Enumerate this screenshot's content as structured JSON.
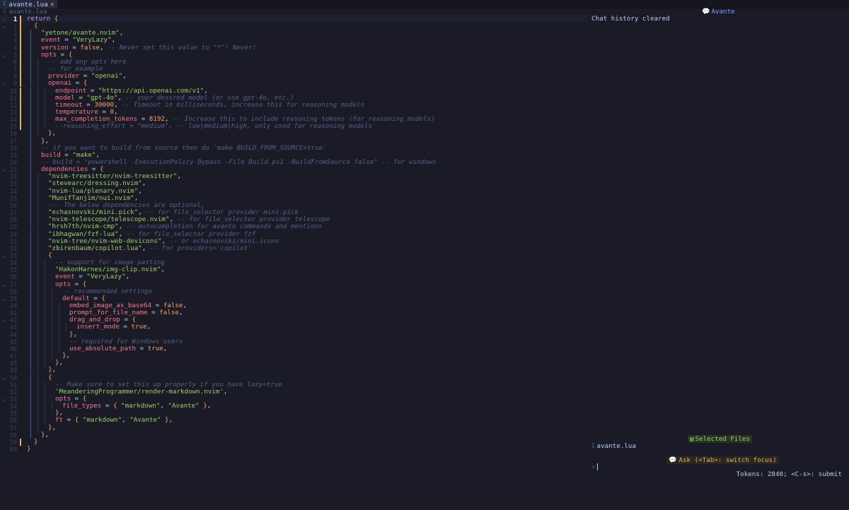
{
  "tab": {
    "icon": "lua-file-icon",
    "label": "avante.lua",
    "close_icon": "close-icon"
  },
  "winbar": {
    "icon": "lua-file-icon",
    "label": "avante.lua"
  },
  "editor": {
    "current_line": 1,
    "lines": [
      {
        "n": "1",
        "fold": "⌄",
        "sign": true,
        "indent": 0,
        "tokens": [
          [
            "k",
            "return"
          ],
          [
            "p",
            " "
          ],
          [
            "br2",
            "{"
          ]
        ]
      },
      {
        "n": "1",
        "fold": "⌄",
        "sign": true,
        "indent": 1,
        "tokens": [
          [
            "br1",
            "{"
          ]
        ]
      },
      {
        "n": "2",
        "sign": true,
        "indent": 2,
        "tokens": [
          [
            "s",
            "\"yetone/avante.nvim\""
          ],
          [
            "p",
            ","
          ]
        ]
      },
      {
        "n": "3",
        "sign": true,
        "indent": 2,
        "tokens": [
          [
            "f",
            "event"
          ],
          [
            "p",
            " = "
          ],
          [
            "s",
            "\"VeryLazy\""
          ],
          [
            "p",
            ","
          ]
        ]
      },
      {
        "n": "4",
        "sign": true,
        "indent": 2,
        "tokens": [
          [
            "f",
            "version"
          ],
          [
            "p",
            " = "
          ],
          [
            "b",
            "false"
          ],
          [
            "p",
            ", "
          ],
          [
            "c",
            "-- Never set this value to \"*\"! Never!"
          ]
        ]
      },
      {
        "n": "5",
        "fold": "⌄",
        "sign": true,
        "indent": 2,
        "tokens": [
          [
            "f",
            "opts"
          ],
          [
            "p",
            " = "
          ],
          [
            "br2",
            "{"
          ]
        ]
      },
      {
        "n": "6",
        "sign": true,
        "indent": 3,
        "tokens": [
          [
            "c",
            "-- add any opts here"
          ]
        ]
      },
      {
        "n": "7",
        "sign": true,
        "indent": 3,
        "tokens": [
          [
            "c",
            "-- for example"
          ]
        ]
      },
      {
        "n": "8",
        "sign": true,
        "indent": 3,
        "tokens": [
          [
            "f",
            "provider"
          ],
          [
            "p",
            " = "
          ],
          [
            "s",
            "\"openai\""
          ],
          [
            "p",
            ","
          ]
        ]
      },
      {
        "n": "9",
        "fold": "⌄",
        "sign": true,
        "indent": 3,
        "tokens": [
          [
            "f",
            "openai"
          ],
          [
            "p",
            " = "
          ],
          [
            "br1",
            "{"
          ]
        ]
      },
      {
        "n": "10",
        "sign": true,
        "indent": 4,
        "tokens": [
          [
            "f",
            "endpoint"
          ],
          [
            "p",
            " = "
          ],
          [
            "s",
            "\"https://api.openai.com/v1\""
          ],
          [
            "p",
            ","
          ]
        ]
      },
      {
        "n": "11",
        "sign": true,
        "indent": 4,
        "tokens": [
          [
            "f",
            "model"
          ],
          [
            "p",
            " = "
          ],
          [
            "s",
            "\"gpt-4o\""
          ],
          [
            "p",
            ", "
          ],
          [
            "c",
            "-- your desired model (or use gpt-4o, etc.)"
          ]
        ]
      },
      {
        "n": "12",
        "sign": true,
        "indent": 4,
        "tokens": [
          [
            "f",
            "timeout"
          ],
          [
            "p",
            " = "
          ],
          [
            "n",
            "30000"
          ],
          [
            "p",
            ", "
          ],
          [
            "c",
            "-- Timeout in milliseconds, increase this for reasoning models"
          ]
        ]
      },
      {
        "n": "13",
        "sign": true,
        "indent": 4,
        "tokens": [
          [
            "f",
            "temperature"
          ],
          [
            "p",
            " = "
          ],
          [
            "n",
            "0"
          ],
          [
            "p",
            ","
          ]
        ]
      },
      {
        "n": "14",
        "sign": true,
        "indent": 4,
        "tokens": [
          [
            "f",
            "max_completion_tokens"
          ],
          [
            "p",
            " = "
          ],
          [
            "n",
            "8192"
          ],
          [
            "p",
            ", "
          ],
          [
            "c",
            "-- Increase this to include reasoning tokens (for reasoning models)"
          ]
        ]
      },
      {
        "n": "15",
        "sign": true,
        "indent": 4,
        "tokens": [
          [
            "c",
            "--reasoning_effort = \"medium\", -- low|medium|high, only used for reasoning models"
          ]
        ]
      },
      {
        "n": "16",
        "indent": 3,
        "tokens": [
          [
            "br1",
            "}"
          ],
          [
            "p",
            ","
          ]
        ]
      },
      {
        "n": "17",
        "indent": 2,
        "tokens": [
          [
            "br2",
            "}"
          ],
          [
            "p",
            ","
          ]
        ]
      },
      {
        "n": "18",
        "indent": 2,
        "tokens": [
          [
            "c",
            "-- if you want to build from source then do `make BUILD_FROM_SOURCE=true`"
          ]
        ]
      },
      {
        "n": "19",
        "indent": 2,
        "tokens": [
          [
            "f",
            "build"
          ],
          [
            "p",
            " = "
          ],
          [
            "s",
            "\"make\""
          ],
          [
            "p",
            ","
          ]
        ]
      },
      {
        "n": "20",
        "indent": 2,
        "tokens": [
          [
            "c",
            "-- build = \"powershell -ExecutionPolicy Bypass -File Build.ps1 -BuildFromSource false\" -- for windows"
          ]
        ]
      },
      {
        "n": "21",
        "fold": "⌄",
        "indent": 2,
        "tokens": [
          [
            "f",
            "dependencies"
          ],
          [
            "p",
            " = "
          ],
          [
            "br2",
            "{"
          ]
        ]
      },
      {
        "n": "22",
        "indent": 3,
        "tokens": [
          [
            "s",
            "\"nvim-treesitter/nvim-treesitter\""
          ],
          [
            "p",
            ","
          ]
        ]
      },
      {
        "n": "23",
        "indent": 3,
        "tokens": [
          [
            "s",
            "\"stevearc/dressing.nvim\""
          ],
          [
            "p",
            ","
          ]
        ]
      },
      {
        "n": "24",
        "indent": 3,
        "tokens": [
          [
            "s",
            "\"nvim-lua/plenary.nvim\""
          ],
          [
            "p",
            ","
          ]
        ]
      },
      {
        "n": "25",
        "indent": 3,
        "tokens": [
          [
            "s",
            "\"MunifTanjim/nui.nvim\""
          ],
          [
            "p",
            ","
          ]
        ]
      },
      {
        "n": "26",
        "indent": 3,
        "tokens": [
          [
            "c",
            "--- The below dependencies are optional,"
          ]
        ]
      },
      {
        "n": "27",
        "indent": 3,
        "tokens": [
          [
            "s",
            "\"echasnovski/mini.pick\""
          ],
          [
            "p",
            ", "
          ],
          [
            "c",
            "-- for file_selector provider mini.pick"
          ]
        ]
      },
      {
        "n": "28",
        "indent": 3,
        "tokens": [
          [
            "s",
            "\"nvim-telescope/telescope.nvim\""
          ],
          [
            "p",
            ", "
          ],
          [
            "c",
            "-- for file_selector provider telescope"
          ]
        ]
      },
      {
        "n": "29",
        "indent": 3,
        "tokens": [
          [
            "s",
            "\"hrsh7th/nvim-cmp\""
          ],
          [
            "p",
            ", "
          ],
          [
            "c",
            "-- autocompletion for avante commands and mentions"
          ]
        ]
      },
      {
        "n": "30",
        "indent": 3,
        "tokens": [
          [
            "s",
            "\"ibhagwan/fzf-lua\""
          ],
          [
            "p",
            ", "
          ],
          [
            "c",
            "-- for file_selector provider fzf"
          ]
        ]
      },
      {
        "n": "31",
        "indent": 3,
        "tokens": [
          [
            "s",
            "\"nvim-tree/nvim-web-devicons\""
          ],
          [
            "p",
            ", "
          ],
          [
            "c",
            "-- or echasnovski/mini.icons"
          ]
        ]
      },
      {
        "n": "32",
        "indent": 3,
        "tokens": [
          [
            "s",
            "\"zbirenbaum/copilot.lua\""
          ],
          [
            "p",
            ", "
          ],
          [
            "c",
            "-- for providers='copilot'"
          ]
        ]
      },
      {
        "n": "33",
        "fold": "⌄",
        "indent": 3,
        "tokens": [
          [
            "br1",
            "{"
          ]
        ]
      },
      {
        "n": "34",
        "indent": 4,
        "tokens": [
          [
            "c",
            "-- support for image pasting"
          ]
        ]
      },
      {
        "n": "35",
        "indent": 4,
        "tokens": [
          [
            "s",
            "\"HakonHarnes/img-clip.nvim\""
          ],
          [
            "p",
            ","
          ]
        ]
      },
      {
        "n": "36",
        "indent": 4,
        "tokens": [
          [
            "f",
            "event"
          ],
          [
            "p",
            " = "
          ],
          [
            "s",
            "\"VeryLazy\""
          ],
          [
            "p",
            ","
          ]
        ]
      },
      {
        "n": "37",
        "fold": "⌄",
        "indent": 4,
        "tokens": [
          [
            "f",
            "opts"
          ],
          [
            "p",
            " = "
          ],
          [
            "br2",
            "{"
          ]
        ]
      },
      {
        "n": "38",
        "indent": 5,
        "tokens": [
          [
            "c",
            "-- recommended settings"
          ]
        ]
      },
      {
        "n": "39",
        "fold": "⌄",
        "indent": 5,
        "tokens": [
          [
            "f",
            "default"
          ],
          [
            "p",
            " = "
          ],
          [
            "br1",
            "{"
          ]
        ]
      },
      {
        "n": "40",
        "indent": 6,
        "tokens": [
          [
            "f",
            "embed_image_as_base64"
          ],
          [
            "p",
            " = "
          ],
          [
            "b",
            "false"
          ],
          [
            "p",
            ","
          ]
        ]
      },
      {
        "n": "41",
        "indent": 6,
        "tokens": [
          [
            "f",
            "prompt_for_file_name"
          ],
          [
            "p",
            " = "
          ],
          [
            "b",
            "false"
          ],
          [
            "p",
            ","
          ]
        ]
      },
      {
        "n": "42",
        "fold": "⌄",
        "indent": 6,
        "tokens": [
          [
            "f",
            "drag_and_drop"
          ],
          [
            "p",
            " = "
          ],
          [
            "br2",
            "{"
          ]
        ]
      },
      {
        "n": "43",
        "indent": 7,
        "tokens": [
          [
            "f",
            "insert_mode"
          ],
          [
            "p",
            " = "
          ],
          [
            "b",
            "true"
          ],
          [
            "p",
            ","
          ]
        ]
      },
      {
        "n": "44",
        "indent": 6,
        "tokens": [
          [
            "br2",
            "}"
          ],
          [
            "p",
            ","
          ]
        ]
      },
      {
        "n": "45",
        "indent": 6,
        "tokens": [
          [
            "c",
            "-- required for Windows users"
          ]
        ]
      },
      {
        "n": "46",
        "indent": 6,
        "tokens": [
          [
            "f",
            "use_absolute_path"
          ],
          [
            "p",
            " = "
          ],
          [
            "b",
            "true"
          ],
          [
            "p",
            ","
          ]
        ]
      },
      {
        "n": "47",
        "indent": 5,
        "tokens": [
          [
            "br1",
            "}"
          ],
          [
            "p",
            ","
          ]
        ]
      },
      {
        "n": "48",
        "indent": 4,
        "tokens": [
          [
            "br2",
            "}"
          ],
          [
            "p",
            ","
          ]
        ]
      },
      {
        "n": "49",
        "indent": 3,
        "tokens": [
          [
            "br1",
            "}"
          ],
          [
            "p",
            ","
          ]
        ]
      },
      {
        "n": "50",
        "fold": "⌄",
        "indent": 3,
        "tokens": [
          [
            "br1",
            "{"
          ]
        ]
      },
      {
        "n": "51",
        "indent": 4,
        "tokens": [
          [
            "c",
            "-- Make sure to set this up properly if you have lazy=true"
          ]
        ]
      },
      {
        "n": "52",
        "indent": 4,
        "tokens": [
          [
            "s",
            "'MeanderingProgrammer/render-markdown.nvim'"
          ],
          [
            "p",
            ","
          ]
        ]
      },
      {
        "n": "53",
        "fold": "⌄",
        "indent": 4,
        "tokens": [
          [
            "f",
            "opts"
          ],
          [
            "p",
            " = "
          ],
          [
            "br2",
            "{"
          ]
        ]
      },
      {
        "n": "54",
        "indent": 5,
        "tokens": [
          [
            "f",
            "file_types"
          ],
          [
            "p",
            " = "
          ],
          [
            "br1",
            "{"
          ],
          [
            "p",
            " "
          ],
          [
            "s",
            "\"markdown\""
          ],
          [
            "p",
            ", "
          ],
          [
            "s",
            "\"Avante\""
          ],
          [
            "p",
            " "
          ],
          [
            "br1",
            "}"
          ],
          [
            "p",
            ","
          ]
        ]
      },
      {
        "n": "55",
        "indent": 4,
        "tokens": [
          [
            "br2",
            "}"
          ],
          [
            "p",
            ","
          ]
        ]
      },
      {
        "n": "56",
        "indent": 4,
        "tokens": [
          [
            "f",
            "ft"
          ],
          [
            "p",
            " = "
          ],
          [
            "br2",
            "{"
          ],
          [
            "p",
            " "
          ],
          [
            "s",
            "\"markdown\""
          ],
          [
            "p",
            ", "
          ],
          [
            "s",
            "\"Avante\""
          ],
          [
            "p",
            " "
          ],
          [
            "br2",
            "}"
          ],
          [
            "p",
            ","
          ]
        ]
      },
      {
        "n": "57",
        "indent": 3,
        "tokens": [
          [
            "br1",
            "}"
          ],
          [
            "p",
            ","
          ]
        ]
      },
      {
        "n": "58",
        "indent": 2,
        "tokens": [
          [
            "br2",
            "}"
          ],
          [
            "p",
            ","
          ]
        ]
      },
      {
        "n": "59",
        "sign": true,
        "indent": 1,
        "tokens": [
          [
            "br1",
            "}"
          ]
        ]
      },
      {
        "n": "60",
        "indent": 0,
        "tokens": [
          [
            "br2",
            "}"
          ]
        ]
      }
    ]
  },
  "chat": {
    "title_icon": "chat-bubble-icon",
    "title": "Avante",
    "message": "Chat history cleared",
    "selected_files_icon": "file-icon",
    "selected_files_label": "Selected Files",
    "file_icon": "lua-file-icon",
    "file_name": "avante.lua",
    "ask_icon": "chat-bubble-icon",
    "ask_label": "Ask (<Tab>: switch focus)",
    "prompt_symbol": ">",
    "tokens": "Tokens: 2840; <C-s>: submit"
  },
  "colors": {
    "background": "#1a1b26",
    "keyword": "#bb9af7",
    "string": "#9ece6a",
    "comment": "#565f89",
    "number": "#ff9e64",
    "field": "#f7768e",
    "accent": "#7aa2f7",
    "git_sign": "#e0af68"
  }
}
